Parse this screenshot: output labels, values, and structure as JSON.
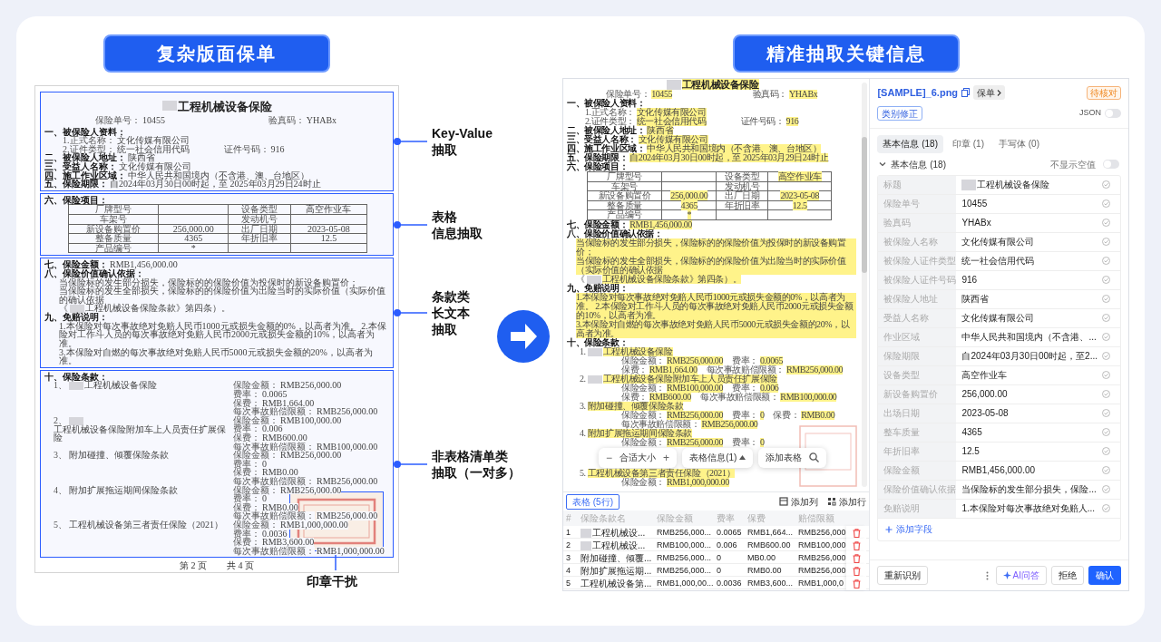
{
  "left_panel": {
    "heading": "复杂版面保单",
    "document": {
      "sections": [
        {
          "annotation": [
            "Key-Value",
            "抽取"
          ],
          "lines": [
            {
              "kind": "title",
              "segments": [
                {
                  "kind": "redaction"
                },
                {
                  "kind": "value",
                  "text": "工程机械设备保险"
                }
              ]
            },
            {
              "kind": "meta",
              "segments": [
                {
                  "kind": "label",
                  "text": "保险单号："
                },
                {
                  "kind": "value",
                  "text": "10455"
                }
              ],
              "right": [
                {
                  "kind": "label",
                  "text": "验真码："
                },
                {
                  "kind": "value",
                  "text": "YHABx"
                }
              ]
            },
            {
              "kind": "heading",
              "segments": [
                {
                  "kind": "heading",
                  "text": "一、被保险人资料："
                }
              ]
            },
            {
              "kind": "item",
              "segments": [
                {
                  "kind": "label",
                  "text": "1.正式名称："
                },
                {
                  "kind": "value",
                  "text": "文化传媒有限公司"
                }
              ]
            },
            {
              "kind": "item",
              "segments": [
                {
                  "kind": "label",
                  "text": "2.证件类型："
                },
                {
                  "kind": "value",
                  "text": "统一社会信用代码"
                }
              ],
              "right": [
                {
                  "kind": "label",
                  "text": "证件号码："
                },
                {
                  "kind": "value",
                  "text": "916"
                }
              ]
            },
            {
              "kind": "heading",
              "segments": [
                {
                  "kind": "heading",
                  "text": "二、被保险人地址："
                },
                {
                  "kind": "value",
                  "text": "陕西省"
                }
              ]
            },
            {
              "kind": "heading",
              "segments": [
                {
                  "kind": "heading",
                  "text": "三、受益人名称："
                },
                {
                  "kind": "value",
                  "text": "文化传媒有限公司"
                }
              ]
            },
            {
              "kind": "heading",
              "segments": [
                {
                  "kind": "heading",
                  "text": "四、施工作业区域："
                },
                {
                  "kind": "value",
                  "text": "中华人民共和国境内（不含港、澳、台地区）"
                }
              ]
            },
            {
              "kind": "heading",
              "segments": [
                {
                  "kind": "heading",
                  "text": "五、保险期限："
                },
                {
                  "kind": "value",
                  "text": "自2024年03月30日00时起，至 2025年03月29日24时止"
                }
              ]
            }
          ]
        },
        {
          "annotation": [
            "表格",
            "信息抽取"
          ],
          "lines": [
            {
              "kind": "heading",
              "segments": [
                {
                  "kind": "heading",
                  "text": "六、保险项目："
                }
              ]
            },
            {
              "kind": "table",
              "rows": [
                [
                  {
                    "kind": "label",
                    "text": "厂牌型号"
                  },
                  {
                    "kind": "empty"
                  },
                  {
                    "kind": "label",
                    "text": "设备类型"
                  },
                  {
                    "kind": "value",
                    "text": "高空作业车"
                  }
                ],
                [
                  {
                    "kind": "label",
                    "text": "车架号"
                  },
                  {
                    "kind": "empty"
                  },
                  {
                    "kind": "label",
                    "text": "发动机号"
                  },
                  {
                    "kind": "empty"
                  }
                ],
                [
                  {
                    "kind": "label",
                    "text": "新设备购置价"
                  },
                  {
                    "kind": "value",
                    "text": "256,000.00"
                  },
                  {
                    "kind": "label",
                    "text": "出厂日期"
                  },
                  {
                    "kind": "value",
                    "text": "2023-05-08"
                  }
                ],
                [
                  {
                    "kind": "label",
                    "text": "整备质量"
                  },
                  {
                    "kind": "value",
                    "text": "4365"
                  },
                  {
                    "kind": "label",
                    "text": "年折旧率"
                  },
                  {
                    "kind": "value",
                    "text": "12.5"
                  }
                ],
                [
                  {
                    "kind": "label",
                    "text": "产品编号"
                  },
                  {
                    "kind": "value",
                    "text": "*"
                  },
                  {
                    "kind": "empty"
                  },
                  {
                    "kind": "empty"
                  }
                ]
              ]
            }
          ]
        },
        {
          "annotation": [
            "条款类",
            "长文本",
            "抽取"
          ],
          "lines": [
            {
              "kind": "heading",
              "segments": [
                {
                  "kind": "heading",
                  "text": "七、保险金额："
                },
                {
                  "kind": "value",
                  "text": "RMB1,456,000.00"
                }
              ]
            },
            {
              "kind": "heading",
              "segments": [
                {
                  "kind": "heading",
                  "text": "八、保险价值确认依据："
                }
              ]
            },
            {
              "kind": "para",
              "segments": [
                {
                  "kind": "value",
                  "text": "当保险标的发生部分损失，保险标的的保险价值为投保时的新设备购置价；"
                }
              ]
            },
            {
              "kind": "para",
              "segments": [
                {
                  "kind": "value",
                  "text": "当保险标的发生全部损失，保险标的的保险价值为出险当时的实际价值（实际价值的确认依据"
                }
              ]
            },
            {
              "kind": "para",
              "segments": [
                {
                  "kind": "label",
                  "text": "《"
                },
                {
                  "kind": "redaction"
                },
                {
                  "kind": "value",
                  "text": "工程机械设备保险条款》第四条）。"
                }
              ]
            },
            {
              "kind": "heading",
              "segments": [
                {
                  "kind": "heading",
                  "text": "九、免赔说明："
                }
              ]
            },
            {
              "kind": "para",
              "segments": [
                {
                  "kind": "value",
                  "text": "1.本保险对每次事故绝对免赔人民币1000元或损失金额的0%，以高者为准。 2.本保险对工作斗人员的每次事故绝对免赔人民币2000元或损失金额的10%，以高者为准。"
                }
              ]
            },
            {
              "kind": "para",
              "segments": [
                {
                  "kind": "value",
                  "text": "3.本保险对自燃的每次事故绝对免赔人民币5000元或损失金额的20%，以高者为准。"
                }
              ]
            }
          ]
        },
        {
          "annotation": [
            "非表格清单类",
            "抽取（一对多）"
          ],
          "lines": [
            {
              "kind": "heading",
              "segments": [
                {
                  "kind": "heading",
                  "text": "十、保险条款："
                }
              ]
            },
            {
              "kind": "clause",
              "name": [
                {
                  "kind": "label",
                  "text": "1、"
                },
                {
                  "kind": "redaction"
                },
                {
                  "kind": "value",
                  "text": "工程机械设备保险"
                }
              ],
              "details": [
                [
                  {
                    "kind": "label",
                    "text": "保险金额："
                  },
                  {
                    "kind": "value",
                    "text": "RMB256,000.00"
                  }
                ],
                [
                  {
                    "kind": "label",
                    "text": "费率："
                  },
                  {
                    "kind": "value",
                    "text": "0.0065"
                  }
                ],
                [
                  {
                    "kind": "label",
                    "text": "保费："
                  },
                  {
                    "kind": "value",
                    "text": "RMB1,664.00"
                  }
                ],
                [
                  {
                    "kind": "label",
                    "text": "每次事故赔偿限额："
                  },
                  {
                    "kind": "value",
                    "text": "RMB256,000.00"
                  }
                ]
              ]
            },
            {
              "kind": "clause",
              "name": [
                {
                  "kind": "label",
                  "text": "2、"
                },
                {
                  "kind": "redaction"
                },
                {
                  "kind": "value",
                  "text": "工程机械设备保险附加车上人员责任扩展保险"
                }
              ],
              "details": [
                [
                  {
                    "kind": "label",
                    "text": "保险金额："
                  },
                  {
                    "kind": "value",
                    "text": "RMB100,000.00"
                  }
                ],
                [
                  {
                    "kind": "label",
                    "text": "费率："
                  },
                  {
                    "kind": "value",
                    "text": "0.006"
                  }
                ],
                [
                  {
                    "kind": "label",
                    "text": "保费："
                  },
                  {
                    "kind": "value",
                    "text": "RMB600.00"
                  }
                ],
                [
                  {
                    "kind": "label",
                    "text": "每次事故赔偿限额："
                  },
                  {
                    "kind": "value",
                    "text": "RMB100,000.00"
                  }
                ]
              ]
            },
            {
              "kind": "clause",
              "name": [
                {
                  "kind": "label",
                  "text": "3、"
                },
                {
                  "kind": "value",
                  "text": "附加碰撞、倾覆保险条款"
                }
              ],
              "details": [
                [
                  {
                    "kind": "label",
                    "text": "保险金额："
                  },
                  {
                    "kind": "value",
                    "text": "RMB256,000.00"
                  }
                ],
                [
                  {
                    "kind": "label",
                    "text": "费率："
                  },
                  {
                    "kind": "value",
                    "text": "0"
                  }
                ],
                [
                  {
                    "kind": "label",
                    "text": "保费："
                  },
                  {
                    "kind": "value",
                    "text": "RMB0.00"
                  }
                ],
                [
                  {
                    "kind": "label",
                    "text": "每次事故赔偿限额："
                  },
                  {
                    "kind": "value",
                    "text": "RMB256,000.00"
                  }
                ]
              ]
            },
            {
              "kind": "clause",
              "name": [
                {
                  "kind": "label",
                  "text": "4、"
                },
                {
                  "kind": "value",
                  "text": "附加扩展拖运期间保险条款"
                }
              ],
              "details": [
                [
                  {
                    "kind": "label",
                    "text": "保险金额："
                  },
                  {
                    "kind": "value",
                    "text": "RMB256,000.00"
                  }
                ],
                [
                  {
                    "kind": "label",
                    "text": "费率："
                  },
                  {
                    "kind": "value",
                    "text": "0"
                  }
                ],
                [
                  {
                    "kind": "label",
                    "text": "保费："
                  },
                  {
                    "kind": "value",
                    "text": "RMB0.00"
                  }
                ],
                [
                  {
                    "kind": "label",
                    "text": "每次事故赔偿限额："
                  },
                  {
                    "kind": "value",
                    "text": "RMB256,000.00"
                  }
                ]
              ]
            },
            {
              "kind": "clause",
              "name": [
                {
                  "kind": "label",
                  "text": "5、"
                },
                {
                  "kind": "value",
                  "text": "工程机械设备第三者责任保险（2021）"
                }
              ],
              "details": [
                [
                  {
                    "kind": "label",
                    "text": "保险金额："
                  },
                  {
                    "kind": "value",
                    "text": "RMB1,000,000.00"
                  }
                ],
                [
                  {
                    "kind": "label",
                    "text": "费率："
                  },
                  {
                    "kind": "value",
                    "text": "0.0036"
                  }
                ],
                [
                  {
                    "kind": "label",
                    "text": "保费："
                  },
                  {
                    "kind": "value",
                    "text": "RMB3,600.00"
                  }
                ],
                [
                  {
                    "kind": "label",
                    "text": "每次事故赔偿限额："
                  },
                  {
                    "kind": "value",
                    "text": "RMB1,000,000.00"
                  }
                ]
              ]
            }
          ]
        }
      ],
      "stamp": {
        "annotation": "印章干扰"
      },
      "footer": [
        "第 2 页",
        "共 4 页"
      ]
    }
  },
  "right_panel": {
    "heading": "精准抽取关键信息",
    "preview": {
      "upper_lines": [
        {
          "kind": "title",
          "segments": [
            {
              "kind": "redaction"
            },
            {
              "kind": "value",
              "text": "工程机械设备保险"
            }
          ]
        },
        {
          "kind": "meta",
          "segments": [
            {
              "kind": "label",
              "text": "保险单号："
            },
            {
              "kind": "value",
              "text": "10455"
            }
          ],
          "right": [
            {
              "kind": "label",
              "text": "验真码："
            },
            {
              "kind": "value",
              "text": "YHABx"
            }
          ]
        },
        {
          "kind": "heading",
          "segments": [
            {
              "kind": "heading",
              "text": "一、被保险人资料："
            }
          ]
        },
        {
          "kind": "item",
          "segments": [
            {
              "kind": "label",
              "text": "1.正式名称："
            },
            {
              "kind": "value",
              "text": "文化传媒有限公司"
            }
          ]
        },
        {
          "kind": "item",
          "segments": [
            {
              "kind": "label",
              "text": "2.证件类型："
            },
            {
              "kind": "value",
              "text": "统一社会信用代码"
            }
          ],
          "right": [
            {
              "kind": "label",
              "text": "证件号码："
            },
            {
              "kind": "value",
              "text": "916"
            }
          ]
        },
        {
          "kind": "heading",
          "segments": [
            {
              "kind": "heading",
              "text": "二、被保险人地址："
            },
            {
              "kind": "value",
              "text": "陕西省"
            }
          ]
        },
        {
          "kind": "heading",
          "segments": [
            {
              "kind": "heading",
              "text": "三、受益人名称："
            },
            {
              "kind": "value",
              "text": "文化传媒有限公司"
            }
          ]
        },
        {
          "kind": "heading",
          "segments": [
            {
              "kind": "heading",
              "text": "四、施工作业区域："
            },
            {
              "kind": "value",
              "text": "中华人民共和国境内（不含港、澳、台地区）"
            }
          ]
        },
        {
          "kind": "heading",
          "segments": [
            {
              "kind": "heading",
              "text": "五、保险期限："
            },
            {
              "kind": "value",
              "text": "自2024年03月30日00时起，至 2025年03月29日24时止"
            }
          ]
        },
        {
          "kind": "heading",
          "segments": [
            {
              "kind": "heading",
              "text": "六、保险项目："
            }
          ]
        },
        {
          "kind": "table",
          "rows": [
            [
              {
                "kind": "label",
                "text": "厂牌型号"
              },
              {
                "kind": "empty"
              },
              {
                "kind": "label",
                "text": "设备类型"
              },
              {
                "kind": "value",
                "text": "高空作业车"
              }
            ],
            [
              {
                "kind": "label",
                "text": "车架号"
              },
              {
                "kind": "empty"
              },
              {
                "kind": "label",
                "text": "发动机号"
              },
              {
                "kind": "empty"
              }
            ],
            [
              {
                "kind": "label",
                "text": "新设备购置价"
              },
              {
                "kind": "value",
                "text": "256,000.00"
              },
              {
                "kind": "label",
                "text": "出厂日期"
              },
              {
                "kind": "value",
                "text": "2023-05-08"
              }
            ],
            [
              {
                "kind": "label",
                "text": "整备质量"
              },
              {
                "kind": "value",
                "text": "4365"
              },
              {
                "kind": "label",
                "text": "年折旧率"
              },
              {
                "kind": "value",
                "text": "12.5"
              }
            ],
            [
              {
                "kind": "label",
                "text": "产品编号"
              },
              {
                "kind": "value",
                "text": "*"
              },
              {
                "kind": "empty"
              },
              {
                "kind": "empty"
              }
            ]
          ]
        },
        {
          "kind": "heading",
          "segments": [
            {
              "kind": "heading",
              "text": "七、保险金额："
            },
            {
              "kind": "value",
              "text": "RMB1,456,000.00"
            }
          ]
        },
        {
          "kind": "heading",
          "segments": [
            {
              "kind": "heading",
              "text": "八、保险价值确认依据："
            }
          ]
        },
        {
          "kind": "para",
          "segments": [
            {
              "kind": "value",
              "text": "当保险标的发生部分损失，保险标的的保险价值为投保时的新设备购置价；"
            }
          ]
        },
        {
          "kind": "para",
          "segments": [
            {
              "kind": "value",
              "text": "当保险标的发生全部损失，保险标的的保险价值为出险当时的实际价值（实际价值的确认依据"
            }
          ]
        },
        {
          "kind": "para",
          "segments": [
            {
              "kind": "label",
              "text": "《"
            },
            {
              "kind": "redaction"
            },
            {
              "kind": "value",
              "text": "工程机械设备保险条款》第四条）。"
            }
          ]
        },
        {
          "kind": "heading",
          "segments": [
            {
              "kind": "heading",
              "text": "九、免赔说明："
            }
          ]
        },
        {
          "kind": "para",
          "segments": [
            {
              "kind": "value",
              "text": "1.本保险对每次事故绝对免赔人民币1000元或损失金额的0%，以高者为准。 2.本保险对工作斗人员的每次事故绝对免赔人民币2000元或损失金额的10%，以高者为准。"
            }
          ]
        },
        {
          "kind": "para",
          "segments": [
            {
              "kind": "value",
              "text": "3.本保险对自燃的每次事故绝对免赔人民币5000元或损失金额的20%，以高者为准。"
            }
          ]
        },
        {
          "kind": "heading",
          "segments": [
            {
              "kind": "heading",
              "text": "十、保险条款："
            }
          ]
        },
        {
          "kind": "clause",
          "name": [
            {
              "kind": "label",
              "text": "1."
            },
            {
              "kind": "redaction"
            },
            {
              "kind": "value",
              "text": "工程机械设备保险"
            }
          ],
          "details": [
            [
              {
                "kind": "label",
                "text": "保险金额："
              },
              {
                "kind": "value",
                "text": "RMB256,000.00"
              }
            ],
            [
              {
                "kind": "label",
                "text": "费率："
              },
              {
                "kind": "value",
                "text": "0.0065"
              }
            ],
            [
              {
                "kind": "label",
                "text": "保费："
              },
              {
                "kind": "value",
                "text": "RMB1,664.00"
              }
            ],
            [
              {
                "kind": "label",
                "text": "每次事故赔偿限额："
              },
              {
                "kind": "value",
                "text": "RMB256,000.00"
              }
            ]
          ]
        },
        {
          "kind": "clause",
          "name": [
            {
              "kind": "label",
              "text": "2."
            },
            {
              "kind": "redaction"
            },
            {
              "kind": "value",
              "text": "工程机械设备保险附加车上人员责任扩展保险"
            }
          ],
          "details": [
            [
              {
                "kind": "label",
                "text": "保险金额："
              },
              {
                "kind": "value",
                "text": "RMB100,000.00"
              }
            ],
            [
              {
                "kind": "label",
                "text": "费率："
              },
              {
                "kind": "value",
                "text": "0.006"
              }
            ],
            [
              {
                "kind": "label",
                "text": "保费："
              },
              {
                "kind": "value",
                "text": "RMB600.00"
              }
            ],
            [
              {
                "kind": "label",
                "text": "每次事故赔偿限额："
              },
              {
                "kind": "value",
                "text": "RMB100,000.00"
              }
            ]
          ]
        },
        {
          "kind": "clause",
          "name": [
            {
              "kind": "label",
              "text": "3."
            },
            {
              "kind": "value",
              "text": "附加碰撞、倾覆保险条款"
            }
          ],
          "details": [
            [
              {
                "kind": "label",
                "text": "保险金额："
              },
              {
                "kind": "value",
                "text": "RMB256,000.00"
              }
            ],
            [
              {
                "kind": "label",
                "text": "费率："
              },
              {
                "kind": "value",
                "text": "0"
              }
            ],
            [
              {
                "kind": "label",
                "text": "保费："
              },
              {
                "kind": "value",
                "text": "RMB0.00"
              }
            ],
            [
              {
                "kind": "label",
                "text": "每次事故赔偿限额："
              },
              {
                "kind": "value",
                "text": "RMB256,000.00"
              }
            ]
          ]
        },
        {
          "kind": "clause",
          "name": [
            {
              "kind": "label",
              "text": "4."
            },
            {
              "kind": "value",
              "text": "附加扩展拖运期间保险条款"
            }
          ],
          "details": [
            [
              {
                "kind": "label",
                "text": "保险金额："
              },
              {
                "kind": "value",
                "text": "RMB256,000.00"
              }
            ],
            [
              {
                "kind": "label",
                "text": "费率："
              },
              {
                "kind": "value",
                "text": "0"
              }
            ]
          ]
        }
      ],
      "toolbar": {
        "zoom_out": "−",
        "zoom_label": "合适大小",
        "zoom_in": "+",
        "table_info": "表格信息(1)",
        "add_table": "添加表格"
      },
      "lower_lines": [
        {
          "kind": "clause",
          "name": [
            {
              "kind": "label",
              "text": "5."
            },
            {
              "kind": "value",
              "text": "工程机械设备第三者责任保险（2021）"
            }
          ],
          "details": [
            [
              {
                "kind": "label",
                "text": "保险金额："
              },
              {
                "kind": "value",
                "text": "RMB1,000,000.00"
              }
            ]
          ]
        }
      ]
    },
    "table": {
      "tab": {
        "label": "表格 (5行)",
        "selected": true
      },
      "add_column": "添加列",
      "add_row": "添加行",
      "columns": [
        "#",
        "保险条款名",
        "保险金额",
        "费率",
        "保费",
        "赔偿限额"
      ],
      "rows": [
        {
          "redacted": true,
          "cells": [
            "1",
            "工程机械设...",
            "RMB256,000...",
            "0.0065",
            "RMB1,664...",
            "RMB256,000"
          ]
        },
        {
          "redacted": true,
          "cells": [
            "2",
            "工程机械设...",
            "RMB100,000...",
            "0.006",
            "RMB600.00",
            "RMB100,000"
          ]
        },
        {
          "redacted": false,
          "cells": [
            "3",
            "附加碰撞、倾覆...",
            "RMB256,000...",
            "0",
            "MB0.00",
            "RMB256,000"
          ]
        },
        {
          "redacted": false,
          "cells": [
            "4",
            "附加扩展拖运期...",
            "RMB256,000...",
            "0",
            "RMB0.00",
            "RMB256,000"
          ]
        },
        {
          "redacted": false,
          "cells": [
            "5",
            "工程机械设备第...",
            "RMB1,000,00...",
            "0.0036",
            "RMB3,600...",
            "RMB1,000,0"
          ]
        }
      ]
    },
    "extraction": {
      "file_name": "[SAMPLE]_6.png",
      "doc_type": "保单",
      "status": "待核对",
      "fix_button": "类别修正",
      "json_toggle": {
        "label": "JSON",
        "on": false
      },
      "tabs": [
        {
          "label": "基本信息 (18)",
          "selected": true
        },
        {
          "label": "印章 (1)",
          "selected": false
        },
        {
          "label": "手写体 (0)",
          "selected": false
        }
      ],
      "group": {
        "title": "基本信息 (18)",
        "expanded": true
      },
      "hide_empty": {
        "label": "不显示空值",
        "on": false
      },
      "fields": [
        {
          "label": "标题",
          "value": "工程机械设备保险",
          "redacted": true
        },
        {
          "label": "保险单号",
          "value": "10455",
          "redacted": false
        },
        {
          "label": "验真码",
          "value": "YHABx",
          "redacted": false
        },
        {
          "label": "被保险人名称",
          "value": "文化传媒有限公司",
          "redacted": false
        },
        {
          "label": "被保险人证件类型",
          "value": "统一社会信用代码",
          "redacted": false
        },
        {
          "label": "被保险人证件号码",
          "value": "916",
          "redacted": false
        },
        {
          "label": "被保险人地址",
          "value": "陕西省",
          "redacted": false
        },
        {
          "label": "受益人名称",
          "value": "文化传媒有限公司",
          "redacted": false
        },
        {
          "label": "作业区域",
          "value": "中华人民共和国境内（不含港、...",
          "redacted": false
        },
        {
          "label": "保险期限",
          "value": "自2024年03月30日00时起，至2...",
          "redacted": false
        },
        {
          "label": "设备类型",
          "value": "高空作业车",
          "redacted": false
        },
        {
          "label": "新设备购置价",
          "value": "256,000.00",
          "redacted": false
        },
        {
          "label": "出场日期",
          "value": "2023-05-08",
          "redacted": false
        },
        {
          "label": "整车质量",
          "value": "4365",
          "redacted": false
        },
        {
          "label": "年折旧率",
          "value": "12.5",
          "redacted": false
        },
        {
          "label": "保险金额",
          "value": "RMB1,456,000.00",
          "redacted": false
        },
        {
          "label": "保险价值确认依据",
          "value": "当保险标的发生部分损失，保险...",
          "redacted": false
        },
        {
          "label": "免赔说明",
          "value": "1.本保险对每次事故绝对免赔人...",
          "redacted": false
        }
      ],
      "add_field": "添加字段",
      "buttons": {
        "rerecognize": "重新识别",
        "ai": "AI问答",
        "reject": "拒绝",
        "confirm": "确认"
      }
    }
  }
}
